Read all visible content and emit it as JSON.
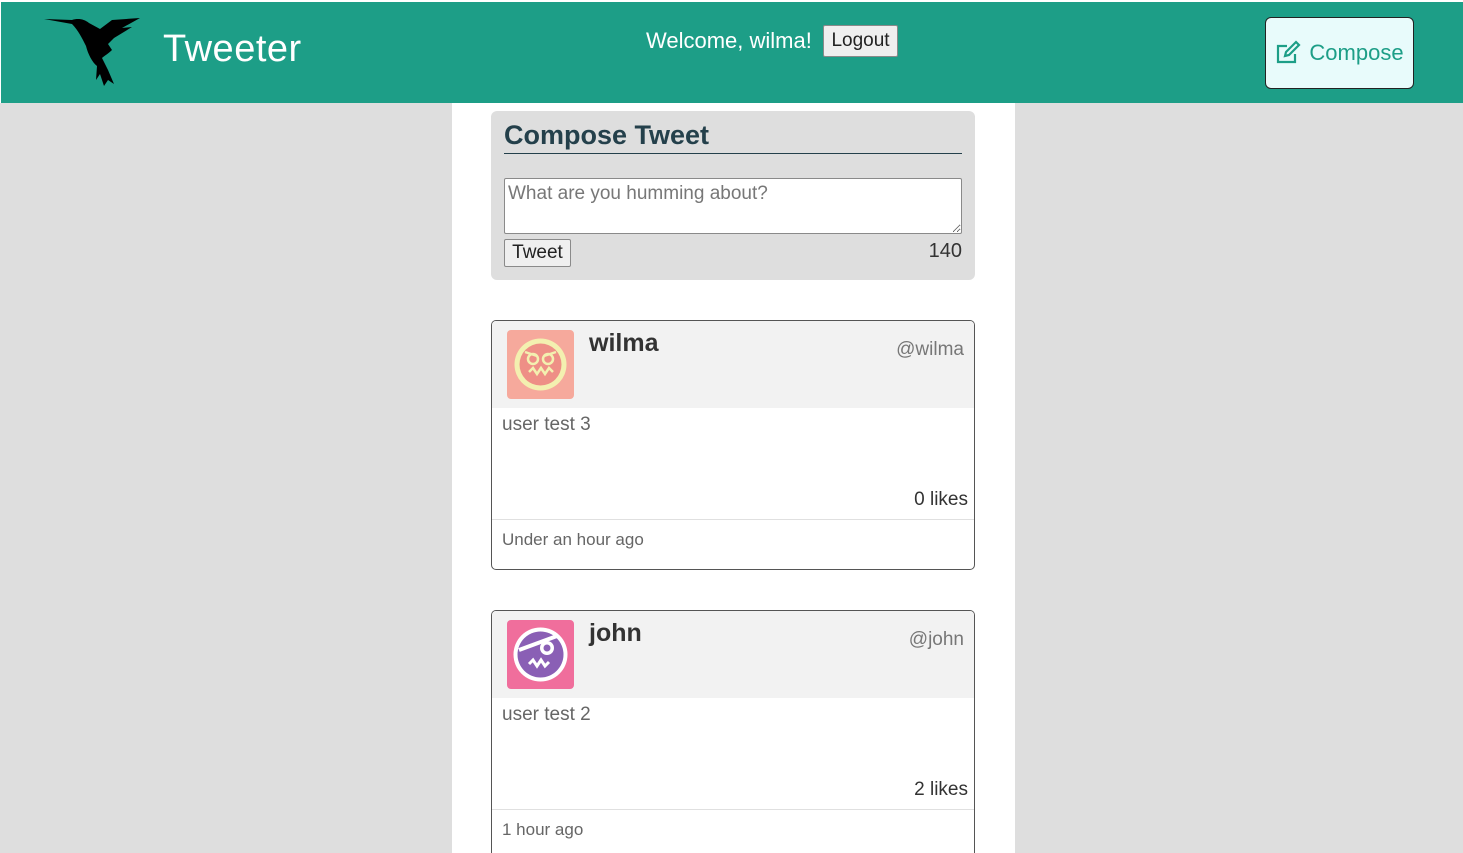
{
  "app": {
    "brand": "Tweeter",
    "logo_icon": "hummingbird-icon"
  },
  "header": {
    "welcome": "Welcome, wilma!",
    "logout_label": "Logout",
    "compose_label": "Compose",
    "compose_icon": "edit-icon"
  },
  "compose": {
    "title": "Compose Tweet",
    "placeholder": "What are you humming about?",
    "value": "",
    "button_label": "Tweet",
    "counter": "140"
  },
  "tweets": [
    {
      "name": "wilma",
      "handle": "@wilma",
      "content": "user test 3",
      "likes": "0 likes",
      "time": "Under an hour ago",
      "avatar_icon": "avatar-face-icon",
      "avatar_colors": {
        "bg": "#f6a99c",
        "ring": "#f3f0b0",
        "face": "#ee8f86"
      }
    },
    {
      "name": "john",
      "handle": "@john",
      "content": "user test 2",
      "likes": "2 likes",
      "time": "1 hour ago",
      "avatar_icon": "avatar-face-icon",
      "avatar_colors": {
        "bg": "#f06e9c",
        "ring": "#ffffff",
        "face": "#8a5fb5"
      }
    }
  ],
  "colors": {
    "brand": "#1d9e87",
    "title": "#24404b",
    "page_bg": "#dedede"
  }
}
